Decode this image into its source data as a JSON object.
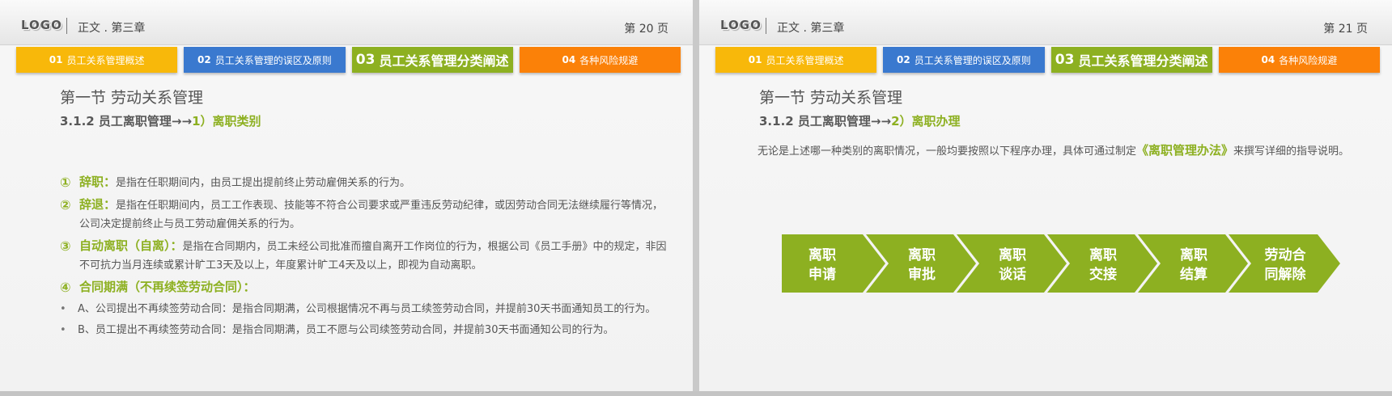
{
  "colors": {
    "tab1": "#f8b80a",
    "tab2": "#3a79cf",
    "tab3": "#8db021",
    "tab4": "#fb8108",
    "accent_green": "#8db021"
  },
  "tabs": [
    {
      "num": "01",
      "label": "员工关系管理概述"
    },
    {
      "num": "02",
      "label": "员工关系管理的误区及原则"
    },
    {
      "num": "03",
      "label": "员工关系管理分类阐述"
    },
    {
      "num": "04",
      "label": "各种风险规避"
    }
  ],
  "slide_left": {
    "logo": "LOGO",
    "chapter": "正文 . 第三章",
    "page": "第 20 页",
    "section_title": "第一节  劳动关系管理",
    "subtitle_prefix": "3.1.2 员工离职管理→→",
    "subtitle_highlight": "1）离职类别",
    "items": [
      {
        "mark": "①",
        "term": "辞职：",
        "text": "是指在任职期间内，由员工提出提前终止劳动雇佣关系的行为。"
      },
      {
        "mark": "②",
        "term": "辞退：",
        "text": "是指在任职期间内，员工工作表现、技能等不符合公司要求或严重违反劳动纪律，或因劳动合同无法继续履行等情况，公司决定提前终止与员工劳动雇佣关系的行为。"
      },
      {
        "mark": "③",
        "term": "自动离职（自离）：",
        "text": "是指在合同期内，员工未经公司批准而擅自离开工作岗位的行为，根据公司《员工手册》中的规定，非因不可抗力当月连续或累计旷工3天及以上，年度累计旷工4天及以上，即视为自动离职。"
      },
      {
        "mark": "④",
        "term": "合同期满（不再续签劳动合同）：",
        "text": ""
      }
    ],
    "bullets": [
      "A、公司提出不再续签劳动合同：是指合同期满，公司根据情况不再与员工续签劳动合同，并提前30天书面通知员工的行为。",
      "B、员工提出不再续签劳动合同：是指合同期满，员工不愿与公司续签劳动合同，并提前30天书面通知公司的行为。"
    ]
  },
  "slide_right": {
    "logo": "LOGO",
    "chapter": "正文 . 第三章",
    "page": "第 21 页",
    "section_title": "第一节  劳动关系管理",
    "subtitle_prefix": "3.1.2 员工离职管理→→",
    "subtitle_highlight": "2）离职办理",
    "intro_before": "无论是上述哪一种类别的离职情况，一般均要按照以下程序办理，具体可通过制定",
    "intro_highlight": "《离职管理办法》",
    "intro_after": "来撰写详细的指导说明。",
    "steps": [
      {
        "line1": "离职",
        "line2": "申请"
      },
      {
        "line1": "离职",
        "line2": "审批"
      },
      {
        "line1": "离职",
        "line2": "谈话"
      },
      {
        "line1": "离职",
        "line2": "交接"
      },
      {
        "line1": "离职",
        "line2": "结算"
      },
      {
        "line1": "劳动合",
        "line2": "同解除"
      }
    ]
  }
}
